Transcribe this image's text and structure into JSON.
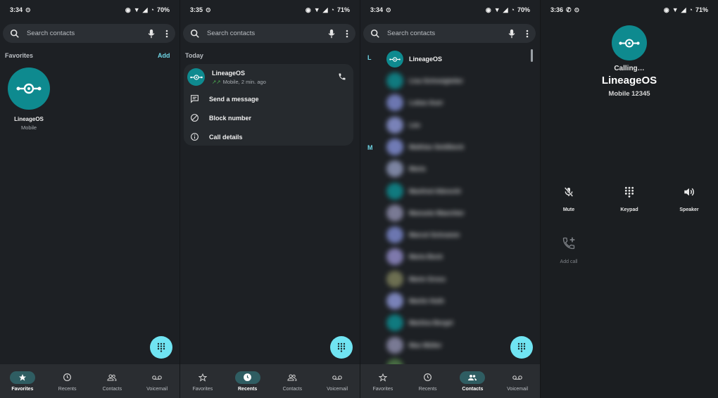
{
  "screens": [
    {
      "status": {
        "time": "3:34",
        "battery": "70%"
      },
      "search": {
        "placeholder": "Search contacts"
      },
      "favorites": {
        "section_label": "Favorites",
        "add_label": "Add",
        "items": [
          {
            "name": "LineageOS",
            "sub": "Mobile"
          }
        ]
      },
      "nav": {
        "active": "Favorites"
      }
    },
    {
      "status": {
        "time": "3:35",
        "battery": "71%"
      },
      "search": {
        "placeholder": "Search contacts"
      },
      "recents": {
        "section_label": "Today",
        "entry": {
          "name": "LineageOS",
          "detail": "Mobile, 2 min. ago"
        },
        "menu": [
          "Send a message",
          "Block number",
          "Call details"
        ]
      },
      "nav": {
        "active": "Recents"
      }
    },
    {
      "status": {
        "time": "3:34",
        "battery": "70%"
      },
      "search": {
        "placeholder": "Search contacts"
      },
      "contacts": {
        "letters": [
          "L",
          "M"
        ],
        "first": "LineageOS",
        "blurred": [
          "Lisa Schneigleiter",
          "Lukas Auer",
          "Léo",
          "Mathias Seidlbeck",
          "Maria",
          "Manfred Albrecht",
          "Manuela Waechter",
          "Marcel Schramm",
          "Maria Bock",
          "Marie Gross",
          "Martin Huth",
          "Martina Bergel",
          "Max Müller",
          ""
        ]
      },
      "nav": {
        "active": "Contacts"
      }
    },
    {
      "status": {
        "time": "3:36",
        "battery": "71%"
      },
      "call": {
        "status": "Calling…",
        "name": "LineageOS",
        "number": "Mobile 12345",
        "buttons": {
          "mute": "Mute",
          "keypad": "Keypad",
          "speaker": "Speaker",
          "add_call": "Add call"
        }
      }
    }
  ],
  "nav_labels": {
    "favorites": "Favorites",
    "recents": "Recents",
    "contacts": "Contacts",
    "voicemail": "Voicemail"
  },
  "colors": {
    "accent": "#6fd6e6",
    "avatar": "#0e8a8f",
    "fab": "#70e4f2",
    "background": "#1d2024",
    "nav_active": "#2f5d62"
  }
}
